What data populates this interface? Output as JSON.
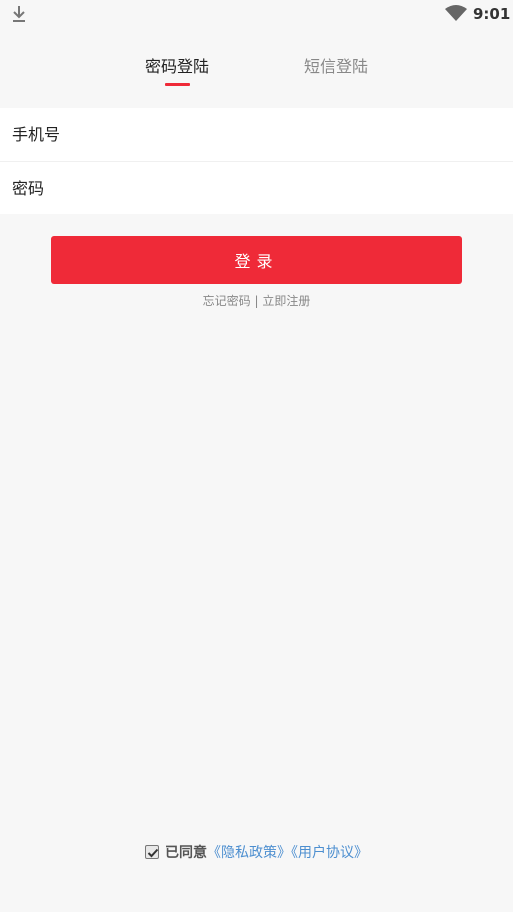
{
  "status_bar": {
    "time": "9:01",
    "download_icon": "download-icon",
    "wifi_icon": "wifi-icon"
  },
  "tabs": [
    {
      "label": "密码登陆",
      "active": true
    },
    {
      "label": "短信登陆",
      "active": false
    }
  ],
  "form": {
    "phone_placeholder": "手机号",
    "phone_value": "",
    "password_placeholder": "密码",
    "password_value": ""
  },
  "login_button_label": "登录",
  "links": {
    "forgot_password": "忘记密码",
    "separator": "|",
    "register": "立即注册"
  },
  "agreement": {
    "checked": true,
    "prefix": "已同意",
    "privacy_policy": "《隐私政策》",
    "user_agreement": "《用户协议》"
  },
  "colors": {
    "accent": "#ef2a38",
    "link": "#4d8fd0",
    "background": "#f7f7f7"
  }
}
